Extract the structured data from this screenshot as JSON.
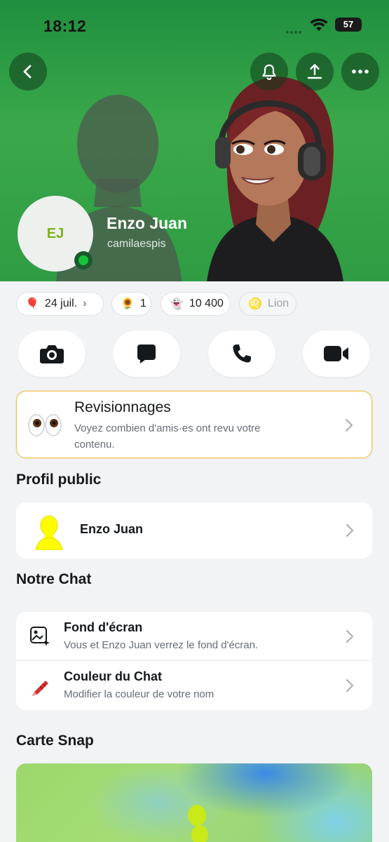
{
  "status_bar": {
    "time": "18:12",
    "battery": "57"
  },
  "header": {
    "initials": "EJ",
    "name": "Enzo Juan",
    "username": "camilaespis",
    "buttons": [
      "back-icon",
      "bell-icon",
      "share-icon",
      "more-icon"
    ]
  },
  "chips": [
    {
      "icon": "🎈",
      "label": "24 juil.",
      "chevron": "›"
    },
    {
      "icon": "🌻",
      "label": "1"
    },
    {
      "icon": "👻",
      "label": "10 400"
    },
    {
      "icon": "♌",
      "label": "Lion"
    }
  ],
  "actions": [
    "camera-icon",
    "chat-icon",
    "phone-icon",
    "video-icon"
  ],
  "revisionnages": {
    "title": "Revisionnages",
    "description": "Voyez combien d'amis·es ont revu votre contenu."
  },
  "profil_public": {
    "section_title": "Profil public",
    "name": "Enzo Juan"
  },
  "notre_chat": {
    "section_title": "Notre Chat",
    "items": [
      {
        "title": "Fond d'écran",
        "subtitle": "Vous et Enzo Juan verrez le fond d'écran."
      },
      {
        "title": "Couleur du Chat",
        "subtitle": "Modifier la couleur de votre nom"
      }
    ]
  },
  "carte_snap": {
    "section_title": "Carte Snap"
  },
  "colors": {
    "header_green": "#2f9c43",
    "accent_yellow": "#fffc00",
    "online_green": "#18c23a",
    "initials": "#7ab317"
  }
}
